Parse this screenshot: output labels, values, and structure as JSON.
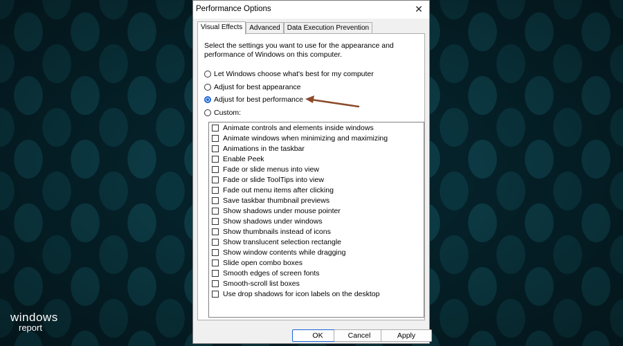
{
  "watermark": {
    "line1": "windows",
    "line2": "report"
  },
  "dialog": {
    "title": "Performance Options",
    "close_symbol": "✕",
    "tabs": [
      {
        "label": "Visual Effects",
        "active": true
      },
      {
        "label": "Advanced",
        "active": false
      },
      {
        "label": "Data Execution Prevention",
        "active": false
      }
    ],
    "description": "Select the settings you want to use for the appearance and performance of Windows on this computer.",
    "radio_options": [
      {
        "label": "Let Windows choose what's best for my computer",
        "checked": false
      },
      {
        "label": "Adjust for best appearance",
        "checked": false
      },
      {
        "label": "Adjust for best performance",
        "checked": true
      },
      {
        "label": "Custom:",
        "checked": false
      }
    ],
    "effects": [
      "Animate controls and elements inside windows",
      "Animate windows when minimizing and maximizing",
      "Animations in the taskbar",
      "Enable Peek",
      "Fade or slide menus into view",
      "Fade or slide ToolTips into view",
      "Fade out menu items after clicking",
      "Save taskbar thumbnail previews",
      "Show shadows under mouse pointer",
      "Show shadows under windows",
      "Show thumbnails instead of icons",
      "Show translucent selection rectangle",
      "Show window contents while dragging",
      "Slide open combo boxes",
      "Smooth edges of screen fonts",
      "Smooth-scroll list boxes",
      "Use drop shadows for icon labels on the desktop"
    ],
    "buttons": {
      "ok": "OK",
      "cancel": "Cancel",
      "apply": "Apply"
    }
  },
  "colors": {
    "accent": "#1a64d8",
    "arrow": "#8b4a2b",
    "background": "#052129"
  },
  "annotation": {
    "icon": "arrow-left-icon"
  }
}
